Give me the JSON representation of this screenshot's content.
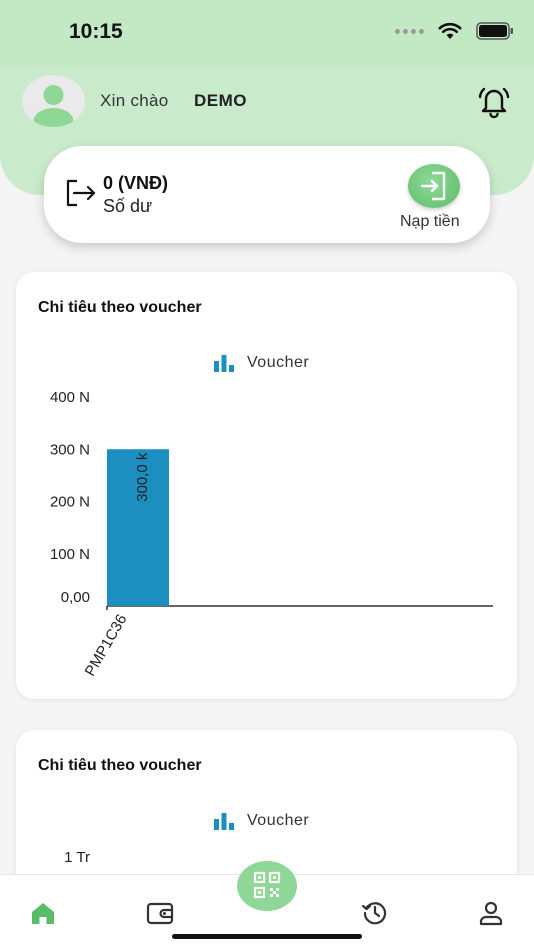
{
  "status": {
    "time": "10:15"
  },
  "header": {
    "greeting": "Xin chào",
    "user_name": "DEMO"
  },
  "balance": {
    "amount": "0  (VNĐ)",
    "label": "Số dư",
    "topup_label": "Nạp tiền"
  },
  "cards": [
    {
      "title": "Chi tiêu theo voucher",
      "legend": "Voucher"
    },
    {
      "title": "Chi tiêu theo voucher",
      "legend": "Voucher"
    }
  ],
  "colors": {
    "accent": "#5cbb69",
    "bar": "#1c8fc0",
    "hero": "#c9ebcb"
  },
  "chart_data": [
    {
      "type": "bar",
      "title": "Chi tiêu theo voucher",
      "legend": [
        "Voucher"
      ],
      "categories": [
        "PMP1C36"
      ],
      "values": [
        300000
      ],
      "value_labels": [
        "300,0 k"
      ],
      "y_ticks": [
        {
          "value": 0,
          "label": "0,00"
        },
        {
          "value": 100000,
          "label": "100 N"
        },
        {
          "value": 200000,
          "label": "200 N"
        },
        {
          "value": 300000,
          "label": "300 N"
        },
        {
          "value": 400000,
          "label": "400 N"
        }
      ],
      "ylim": [
        0,
        400000
      ]
    },
    {
      "type": "bar",
      "title": "Chi tiêu theo voucher",
      "legend": [
        "Voucher"
      ],
      "y_ticks": [
        {
          "value": 1000000,
          "label": "1 Tr"
        }
      ]
    }
  ],
  "nav": {
    "items": [
      "home-icon",
      "wallet-icon",
      "qr-icon",
      "history-icon",
      "profile-icon"
    ],
    "active": "home-icon"
  }
}
